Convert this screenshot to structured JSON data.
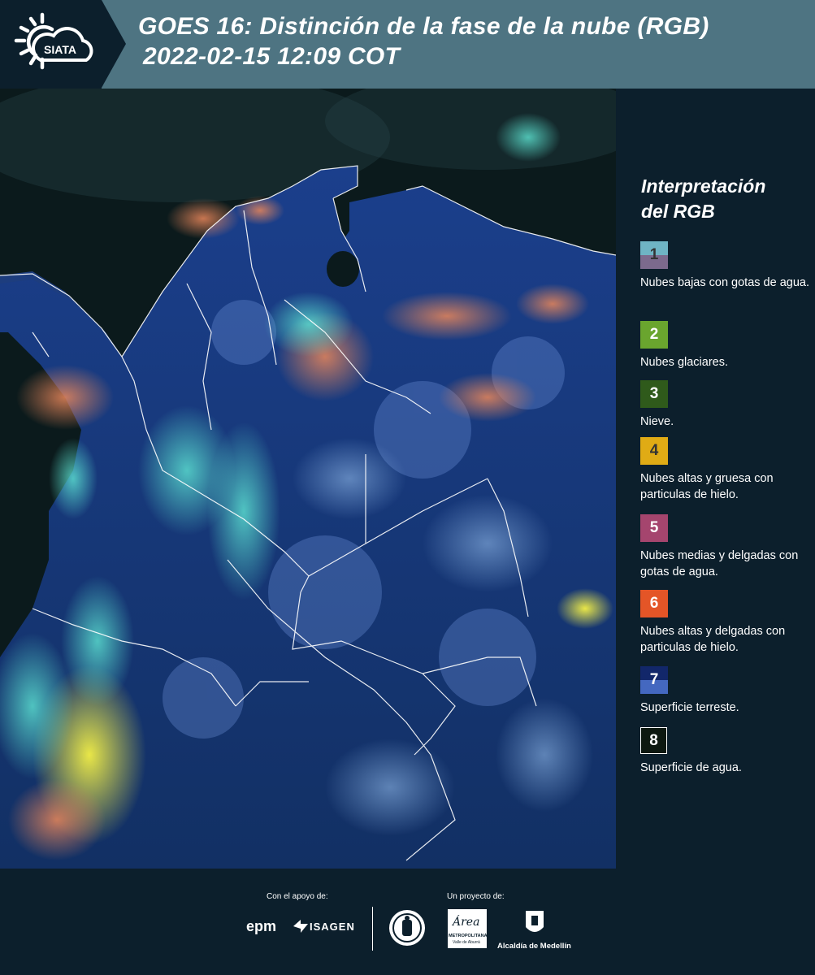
{
  "header": {
    "logo_text": "SIATA",
    "title_line1": "GOES 16: Distinción de la fase de la nube (RGB)",
    "title_line2": "2022-02-15 12:09 COT"
  },
  "legend": {
    "title_line1": "Interpretación",
    "title_line2": "del RGB",
    "items": [
      {
        "num": "1",
        "label": "Nubes bajas con gotas de agua.",
        "color_top": "#6fb4c4",
        "color_bottom": "#7c6a8d"
      },
      {
        "num": "2",
        "label": "Nubes glaciares.",
        "color_top": "#6aa52e",
        "color_bottom": "#6aa52e"
      },
      {
        "num": "3",
        "label": "Nieve.",
        "color_top": "#2f5a1b",
        "color_bottom": "#2f5a1b"
      },
      {
        "num": "4",
        "label": "Nubes altas y gruesa con particulas de hielo.",
        "color_top": "#e0ab15",
        "color_bottom": "#e0ab15"
      },
      {
        "num": "5",
        "label": "Nubes medias y delgadas con gotas de agua.",
        "color_top": "#a5456e",
        "color_bottom": "#a5456e"
      },
      {
        "num": "6",
        "label": "Nubes altas y delgadas con particulas de hielo.",
        "color_top": "#e45527",
        "color_bottom": "#e45527"
      },
      {
        "num": "7",
        "label": "Superficie terreste.",
        "color_top": "#12276a",
        "color_bottom": "#4468c0"
      },
      {
        "num": "8",
        "label": "Superficie de agua.",
        "color_top": "#0d1810",
        "color_bottom": "#0d1810"
      }
    ]
  },
  "footer": {
    "support_label": "Con el apoyo de:",
    "project_label": "Un proyecto de:",
    "logo_epm": "epm",
    "logo_isagen": "ISAGEN",
    "logo_area_line1": "Área",
    "logo_area_line2": "METROPOLITANA",
    "logo_area_line3": "Valle de Aburrá",
    "logo_alcaldia": "Alcaldía de Medellín"
  }
}
